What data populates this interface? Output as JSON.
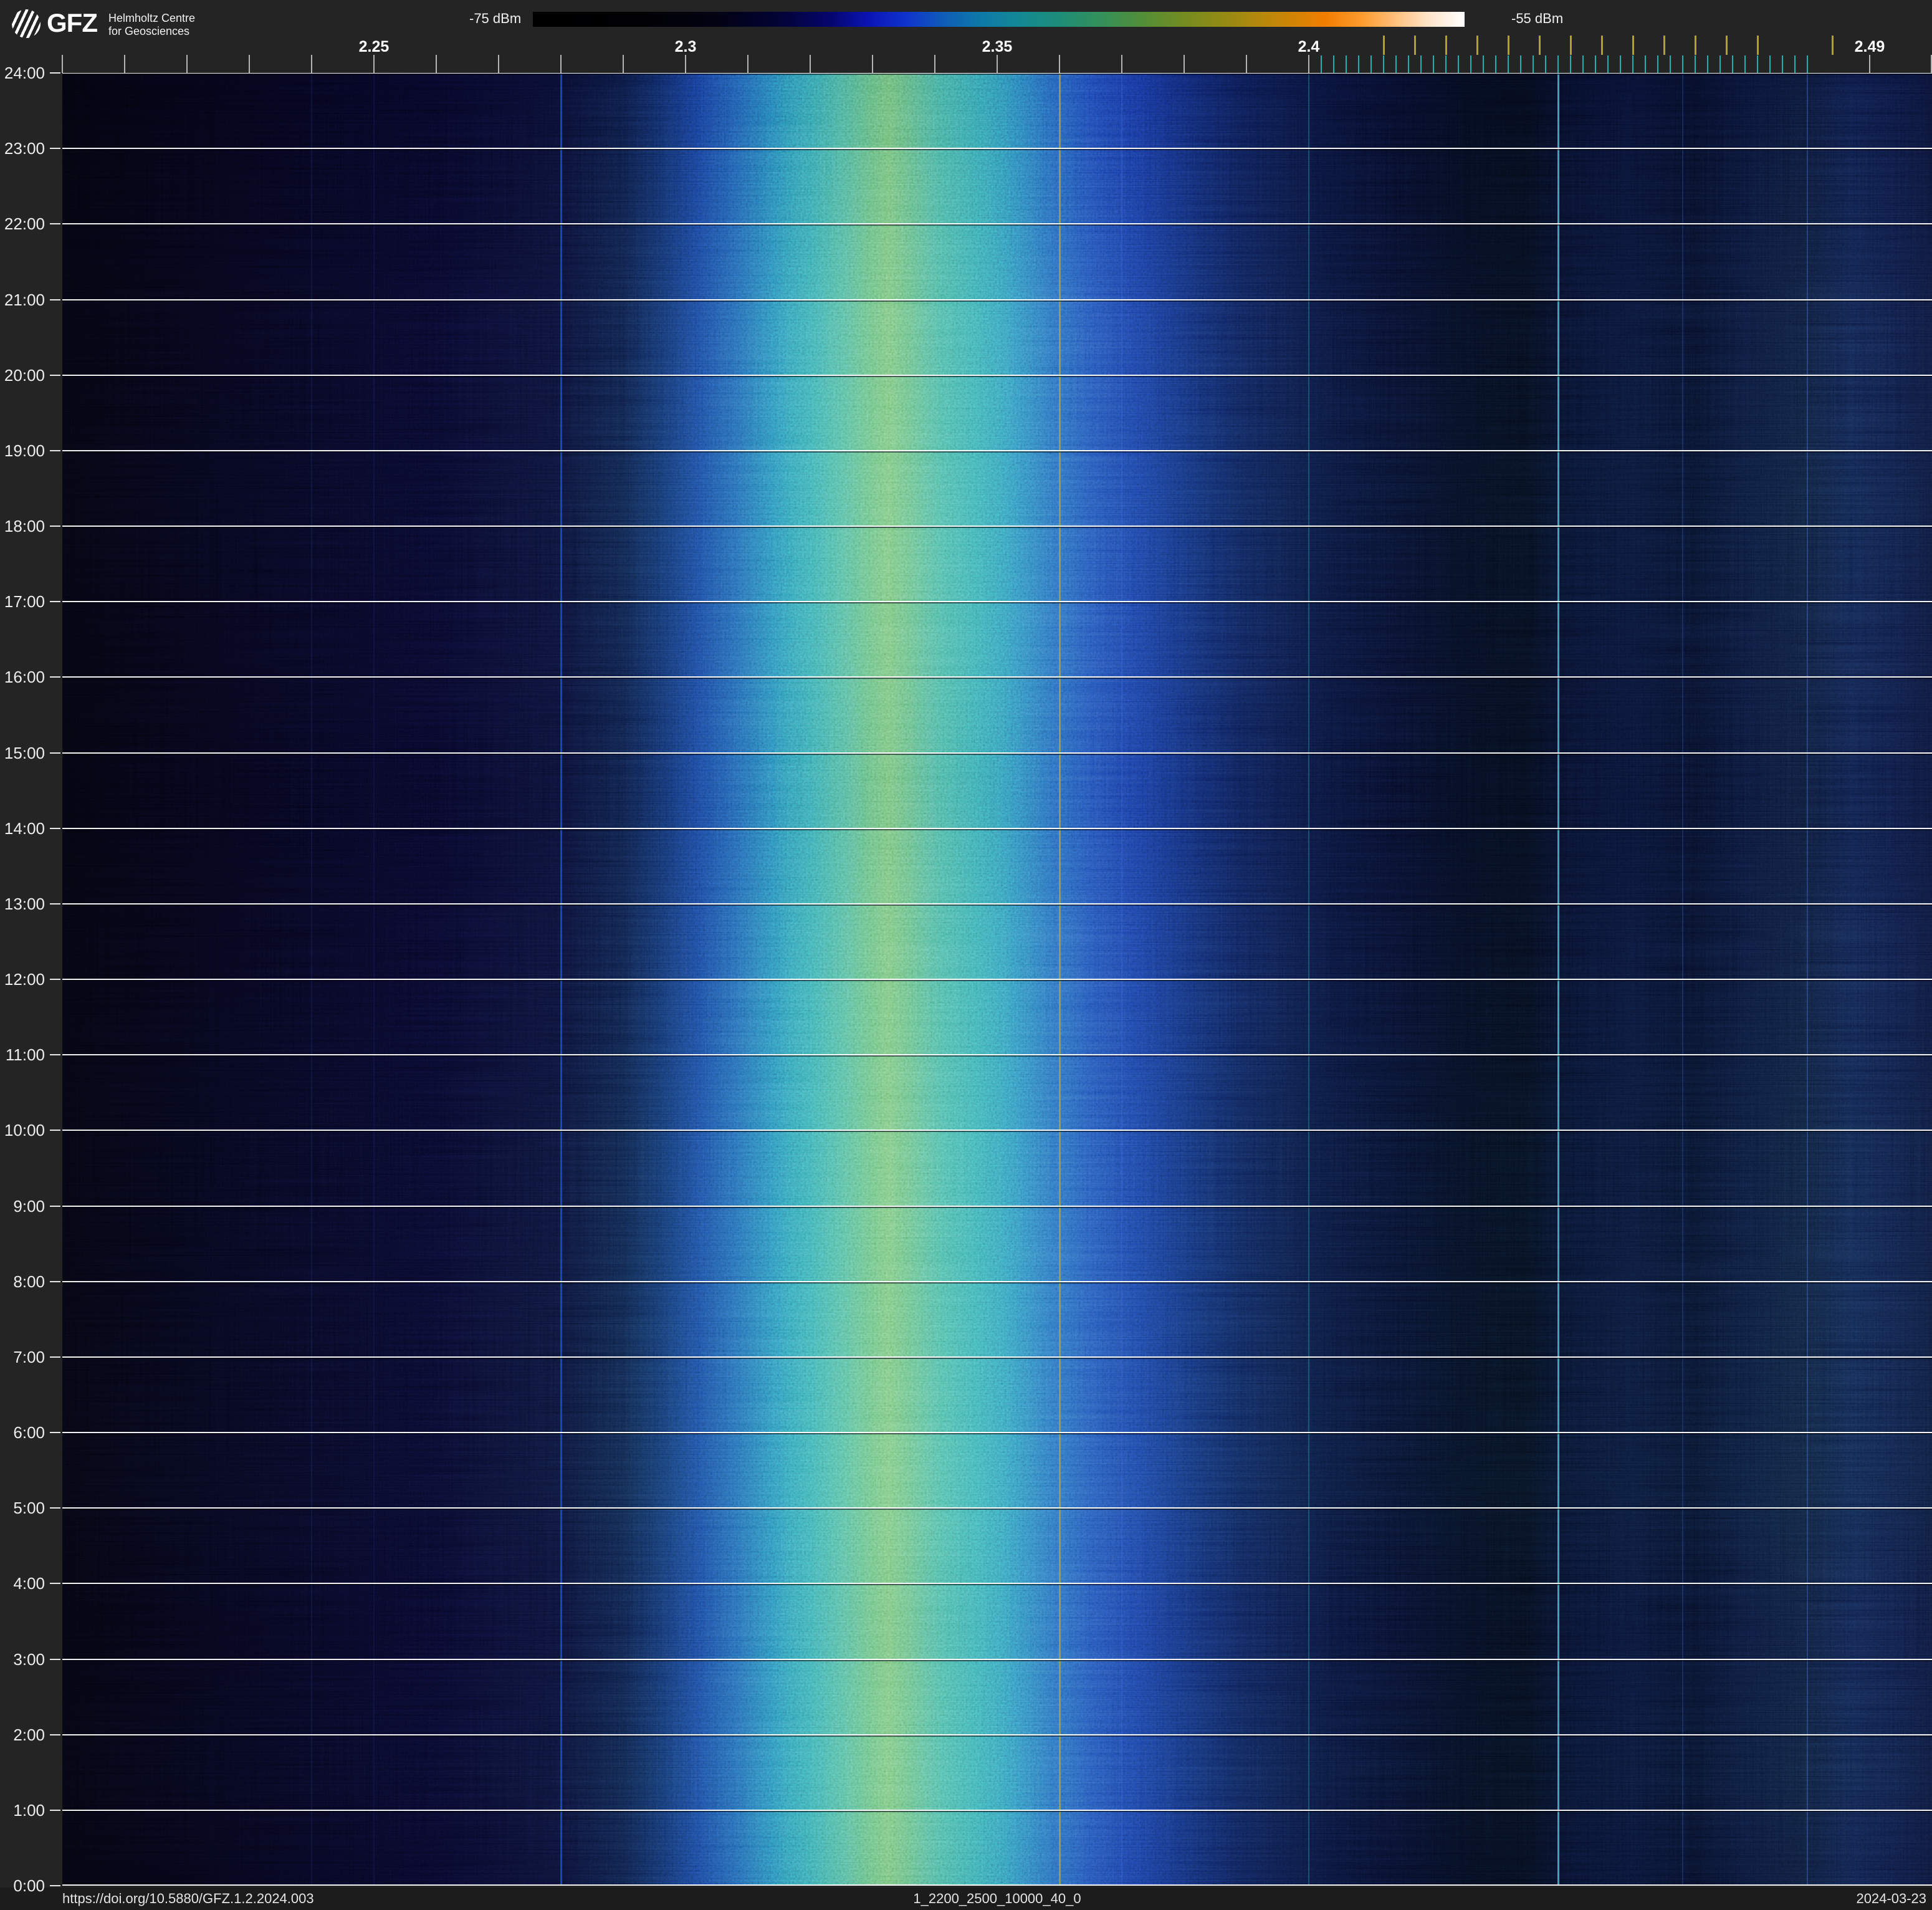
{
  "header": {
    "brand": "GFZ",
    "org_line1": "Helmholtz Centre",
    "org_line2": "for Geosciences",
    "colorbar_min": "-75 dBm",
    "colorbar_max": "-55 dBm",
    "colorbar_stops": [
      {
        "p": 0,
        "c": "#000000"
      },
      {
        "p": 12,
        "c": "#010104"
      },
      {
        "p": 20,
        "c": "#020213"
      },
      {
        "p": 27,
        "c": "#03033a"
      },
      {
        "p": 32,
        "c": "#05056e"
      },
      {
        "p": 36,
        "c": "#0a14b4"
      },
      {
        "p": 40,
        "c": "#1032cc"
      },
      {
        "p": 44,
        "c": "#0f5cb8"
      },
      {
        "p": 48,
        "c": "#0e79a8"
      },
      {
        "p": 52,
        "c": "#128896"
      },
      {
        "p": 56,
        "c": "#1b8d7c"
      },
      {
        "p": 61,
        "c": "#33905a"
      },
      {
        "p": 66,
        "c": "#578e34"
      },
      {
        "p": 71,
        "c": "#7c8c1c"
      },
      {
        "p": 76,
        "c": "#a38a10"
      },
      {
        "p": 81,
        "c": "#cd8506"
      },
      {
        "p": 85,
        "c": "#f07d00"
      },
      {
        "p": 89,
        "c": "#ff9c2e"
      },
      {
        "p": 93,
        "c": "#ffc486"
      },
      {
        "p": 96,
        "c": "#ffe3c8"
      },
      {
        "p": 100,
        "c": "#ffffff"
      }
    ]
  },
  "footer": {
    "doi": "https://doi.org/10.5880/GFZ.1.2.2024.003",
    "dataset_id": "1_2200_2500_10000_40_0",
    "date": "2024-03-23"
  },
  "time_axis": {
    "labels": [
      "24:00",
      "23:00",
      "22:00",
      "21:00",
      "20:00",
      "19:00",
      "18:00",
      "17:00",
      "16:00",
      "15:00",
      "14:00",
      "13:00",
      "12:00",
      "11:00",
      "10:00",
      "9:00",
      "8:00",
      "7:00",
      "6:00",
      "5:00",
      "4:00",
      "3:00",
      "2:00",
      "1:00",
      "0:00"
    ]
  },
  "freq_axis": {
    "start_ghz": 2.2,
    "end_ghz": 2.5,
    "major_labels": [
      {
        "ghz": 2.25,
        "text": "2.25"
      },
      {
        "ghz": 2.3,
        "text": "2.3"
      },
      {
        "ghz": 2.35,
        "text": "2.35"
      },
      {
        "ghz": 2.4,
        "text": "2.4"
      },
      {
        "ghz": 2.49,
        "text": "2.49"
      }
    ],
    "minor_ticks_ghz": [
      2.2,
      2.21,
      2.22,
      2.23,
      2.24,
      2.25,
      2.26,
      2.27,
      2.28,
      2.29,
      2.3,
      2.31,
      2.32,
      2.33,
      2.34,
      2.35,
      2.36,
      2.37,
      2.38,
      2.39,
      2.4,
      2.49,
      2.4999
    ],
    "minor_tick_color": "#b5b5b5",
    "wifi_ticks_mhz": [
      2412,
      2417,
      2422,
      2427,
      2432,
      2437,
      2442,
      2447,
      2452,
      2457,
      2462,
      2467,
      2472,
      2484
    ],
    "wifi_tick_color": "#b0a41e",
    "ble_ticks_mhz": [
      2402,
      2404,
      2406,
      2408,
      2410,
      2412,
      2414,
      2416,
      2418,
      2420,
      2422,
      2424,
      2426,
      2428,
      2430,
      2432,
      2434,
      2436,
      2438,
      2440,
      2442,
      2444,
      2446,
      2448,
      2450,
      2452,
      2454,
      2456,
      2458,
      2460,
      2462,
      2464,
      2466,
      2468,
      2470,
      2472,
      2474,
      2476,
      2478,
      2480
    ],
    "ble_tick_color": "#1db1b1"
  },
  "features": {
    "vertical_lines": [
      {
        "ghz": 2.24,
        "color": "rgba(45,65,170,0.20)",
        "w": 2
      },
      {
        "ghz": 2.25,
        "color": "rgba(45,65,170,0.16)",
        "w": 2
      },
      {
        "ghz": 2.28,
        "color": "rgba(35,85,250,0.70)",
        "w": 3
      },
      {
        "ghz": 2.36,
        "color": "rgba(185,155,40,0.85)",
        "w": 3
      },
      {
        "ghz": 2.37,
        "color": "rgba(70,110,230,0.30)",
        "w": 2
      },
      {
        "ghz": 2.4,
        "color": "rgba(45,165,175,0.38)",
        "w": 2
      },
      {
        "ghz": 2.44,
        "color": "rgba(70,200,215,0.80)",
        "w": 3
      },
      {
        "ghz": 2.46,
        "color": "rgba(60,110,235,0.25)",
        "w": 2
      },
      {
        "ghz": 2.48,
        "color": "rgba(75,125,245,0.35)",
        "w": 2
      }
    ]
  },
  "render": {
    "profile_gradient": [
      {
        "p": 0,
        "c": "#020208"
      },
      {
        "p": 10,
        "c": "#030310"
      },
      {
        "p": 20,
        "c": "#04041a"
      },
      {
        "p": 26.7,
        "c": "#060923"
      },
      {
        "p": 30,
        "c": "#081334"
      },
      {
        "p": 32,
        "c": "#0b2154"
      },
      {
        "p": 34,
        "c": "#10337c"
      },
      {
        "p": 36,
        "c": "#175098"
      },
      {
        "p": 38,
        "c": "#1d73a2"
      },
      {
        "p": 40,
        "c": "#2b9199"
      },
      {
        "p": 41.7,
        "c": "#41a382"
      },
      {
        "p": 43.2,
        "c": "#55ab6c"
      },
      {
        "p": 44.2,
        "c": "#63b166"
      },
      {
        "p": 45.2,
        "c": "#55aa6f"
      },
      {
        "p": 47,
        "c": "#3ba088"
      },
      {
        "p": 49,
        "c": "#2b929a"
      },
      {
        "p": 51,
        "c": "#2276a7"
      },
      {
        "p": 53,
        "c": "#1c57a7"
      },
      {
        "p": 55,
        "c": "#173f9e"
      },
      {
        "p": 57,
        "c": "#112f87"
      },
      {
        "p": 59,
        "c": "#0d246e"
      },
      {
        "p": 61,
        "c": "#0a1b56"
      },
      {
        "p": 63,
        "c": "#081442"
      },
      {
        "p": 65.3,
        "c": "#071034"
      },
      {
        "p": 68,
        "c": "#050b26"
      },
      {
        "p": 71.3,
        "c": "#04081c"
      },
      {
        "p": 75,
        "c": "#030713"
      },
      {
        "p": 78.3,
        "c": "#030711"
      },
      {
        "p": 80.7,
        "c": "#04091d"
      },
      {
        "p": 84,
        "c": "#050b23"
      },
      {
        "p": 87.3,
        "c": "#04091b"
      },
      {
        "p": 90,
        "c": "#060d26"
      },
      {
        "p": 93.3,
        "c": "#081129"
      },
      {
        "p": 95.7,
        "c": "#091437"
      },
      {
        "p": 98,
        "c": "#081030"
      },
      {
        "p": 100,
        "c": "#070d27"
      }
    ]
  },
  "chart_data": {
    "type": "heatmap",
    "title": "1_2200_2500_10000_40_0",
    "date": "2024-03-23",
    "x_axis": {
      "label": "frequency_ghz",
      "range": [
        2.2,
        2.5
      ],
      "major_ticks": [
        2.25,
        2.3,
        2.35,
        2.4,
        2.49
      ],
      "minor_tick_step_ghz": 0.01
    },
    "y_axis": {
      "label": "time_of_day",
      "top": "24:00",
      "bottom": "0:00",
      "tick_step_hours": 1,
      "grid": true
    },
    "color_scale": {
      "unit": "dBm",
      "min_dbm": -75,
      "max_dbm": -55
    },
    "wifi_channel_markers_mhz": [
      2412,
      2417,
      2422,
      2427,
      2432,
      2437,
      2442,
      2447,
      2452,
      2457,
      2462,
      2467,
      2472,
      2484
    ],
    "ble_channel_markers_mhz": [
      2402,
      2404,
      2406,
      2408,
      2410,
      2412,
      2414,
      2416,
      2418,
      2420,
      2422,
      2424,
      2426,
      2428,
      2430,
      2432,
      2434,
      2436,
      2438,
      2440,
      2442,
      2444,
      2446,
      2448,
      2450,
      2452,
      2454,
      2456,
      2458,
      2460,
      2462,
      2464,
      2466,
      2468,
      2470,
      2472,
      2474,
      2476,
      2478,
      2480
    ],
    "persistent_carrier_lines_ghz": [
      2.28,
      2.36,
      2.37,
      2.4,
      2.44,
      2.46,
      2.48
    ],
    "main_emission_band": {
      "center_ghz": 2.332,
      "core_halfwidth_mhz": 8,
      "visible_span_ghz": [
        2.295,
        2.385
      ],
      "peak_level_dbm": -62,
      "presence": "continuous 0:00-24:00"
    },
    "time_averaged_spectrum": [
      {
        "ghz": 2.2,
        "dbm": -75.0
      },
      {
        "ghz": 2.24,
        "dbm": -74.5
      },
      {
        "ghz": 2.27,
        "dbm": -74.0
      },
      {
        "ghz": 2.28,
        "dbm": -72.5
      },
      {
        "ghz": 2.29,
        "dbm": -72.0
      },
      {
        "ghz": 2.295,
        "dbm": -70.5
      },
      {
        "ghz": 2.3,
        "dbm": -69.0
      },
      {
        "ghz": 2.305,
        "dbm": -68.0
      },
      {
        "ghz": 2.31,
        "dbm": -66.5
      },
      {
        "ghz": 2.315,
        "dbm": -65.0
      },
      {
        "ghz": 2.32,
        "dbm": -64.0
      },
      {
        "ghz": 2.325,
        "dbm": -63.0
      },
      {
        "ghz": 2.33,
        "dbm": -62.2
      },
      {
        "ghz": 2.333,
        "dbm": -62.0
      },
      {
        "ghz": 2.335,
        "dbm": -62.3
      },
      {
        "ghz": 2.34,
        "dbm": -63.0
      },
      {
        "ghz": 2.345,
        "dbm": -63.8
      },
      {
        "ghz": 2.35,
        "dbm": -64.8
      },
      {
        "ghz": 2.355,
        "dbm": -65.8
      },
      {
        "ghz": 2.36,
        "dbm": -67.0
      },
      {
        "ghz": 2.365,
        "dbm": -68.2
      },
      {
        "ghz": 2.37,
        "dbm": -69.5
      },
      {
        "ghz": 2.38,
        "dbm": -71.5
      },
      {
        "ghz": 2.39,
        "dbm": -73.0
      },
      {
        "ghz": 2.4,
        "dbm": -73.8
      },
      {
        "ghz": 2.42,
        "dbm": -74.3
      },
      {
        "ghz": 2.44,
        "dbm": -73.8
      },
      {
        "ghz": 2.46,
        "dbm": -73.5
      },
      {
        "ghz": 2.47,
        "dbm": -74.0
      },
      {
        "ghz": 2.48,
        "dbm": -73.0
      },
      {
        "ghz": 2.49,
        "dbm": -72.8
      },
      {
        "ghz": 2.5,
        "dbm": -73.0
      }
    ]
  }
}
